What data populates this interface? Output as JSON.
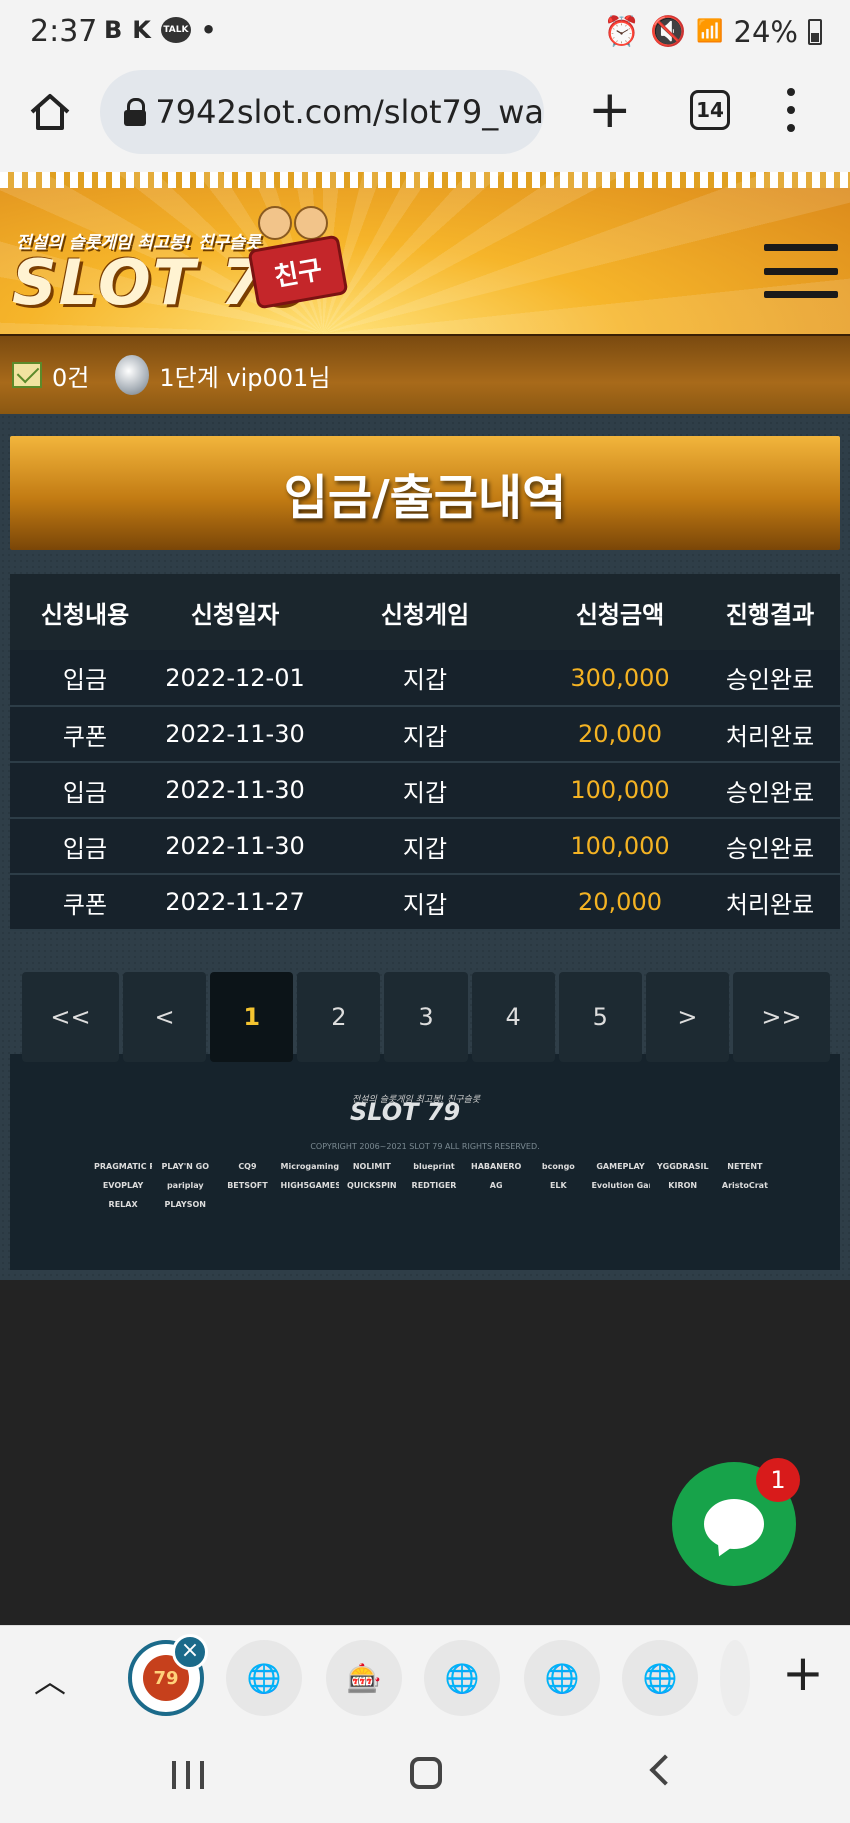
{
  "status": {
    "time": "2:37",
    "left_icons": [
      "B",
      "K",
      "TALK",
      "•"
    ],
    "battery": "24%"
  },
  "browser": {
    "url": "7942slot.com/slot79_wa",
    "tab_count": "14"
  },
  "header": {
    "tagline": "전설의 슬롯게임 최고봉! 친구슬롯",
    "logo": "SLOT 79",
    "badge": "친구"
  },
  "user": {
    "messages": "0건",
    "level_user": "1단계 vip001님"
  },
  "page": {
    "title": "입금/출금내역"
  },
  "table": {
    "headers": [
      "신청내용",
      "신청일자",
      "신청게임",
      "신청금액",
      "진행결과"
    ],
    "rows": [
      {
        "type": "입금",
        "date": "2022-12-01",
        "game": "지갑",
        "amount": "300,000",
        "result": "승인완료"
      },
      {
        "type": "쿠폰",
        "date": "2022-11-30",
        "game": "지갑",
        "amount": "20,000",
        "result": "처리완료"
      },
      {
        "type": "입금",
        "date": "2022-11-30",
        "game": "지갑",
        "amount": "100,000",
        "result": "승인완료"
      },
      {
        "type": "입금",
        "date": "2022-11-30",
        "game": "지갑",
        "amount": "100,000",
        "result": "승인완료"
      },
      {
        "type": "쿠폰",
        "date": "2022-11-27",
        "game": "지갑",
        "amount": "20,000",
        "result": "처리완료"
      }
    ]
  },
  "pagination": {
    "first": "<<",
    "prev": "<",
    "pages": [
      "1",
      "2",
      "3",
      "4",
      "5"
    ],
    "current": "1",
    "next": ">",
    "last": ">>"
  },
  "footer": {
    "tagline": "전설의 슬롯게임 최고봉! 친구슬롯",
    "logo": "SLOT 79",
    "copyright": "COPYRIGHT 2006~2021 SLOT 79 ALL RIGHTS RESERVED.",
    "providers": [
      "PRAGMATIC PLAY",
      "PLAY'N GO",
      "CQ9",
      "Microgaming",
      "NOLIMIT",
      "blueprint",
      "HABANERO",
      "bcongo",
      "GAMEPLAY",
      "YGGDRASIL",
      "NETENT",
      "EVOPLAY",
      "pariplay",
      "BETSOFT",
      "HIGH5GAMES",
      "QUICKSPIN",
      "REDTIGER",
      "AG",
      "ELK",
      "Evolution Gaming",
      "KIRON",
      "AristoCrat",
      "RELAX",
      "PLAYSON"
    ]
  },
  "chat": {
    "badge_count": "1"
  },
  "tabs": {
    "current_label": "79",
    "collapse_icon": "chevron-up-icon",
    "others": [
      "globe-icon",
      "slot-machine-icon",
      "globe-icon",
      "globe-icon",
      "globe-icon"
    ]
  },
  "colors": {
    "amount": "#f4b323",
    "active_page": "#f4c430",
    "chat": "#17a34a",
    "badge": "#d81b1b"
  }
}
